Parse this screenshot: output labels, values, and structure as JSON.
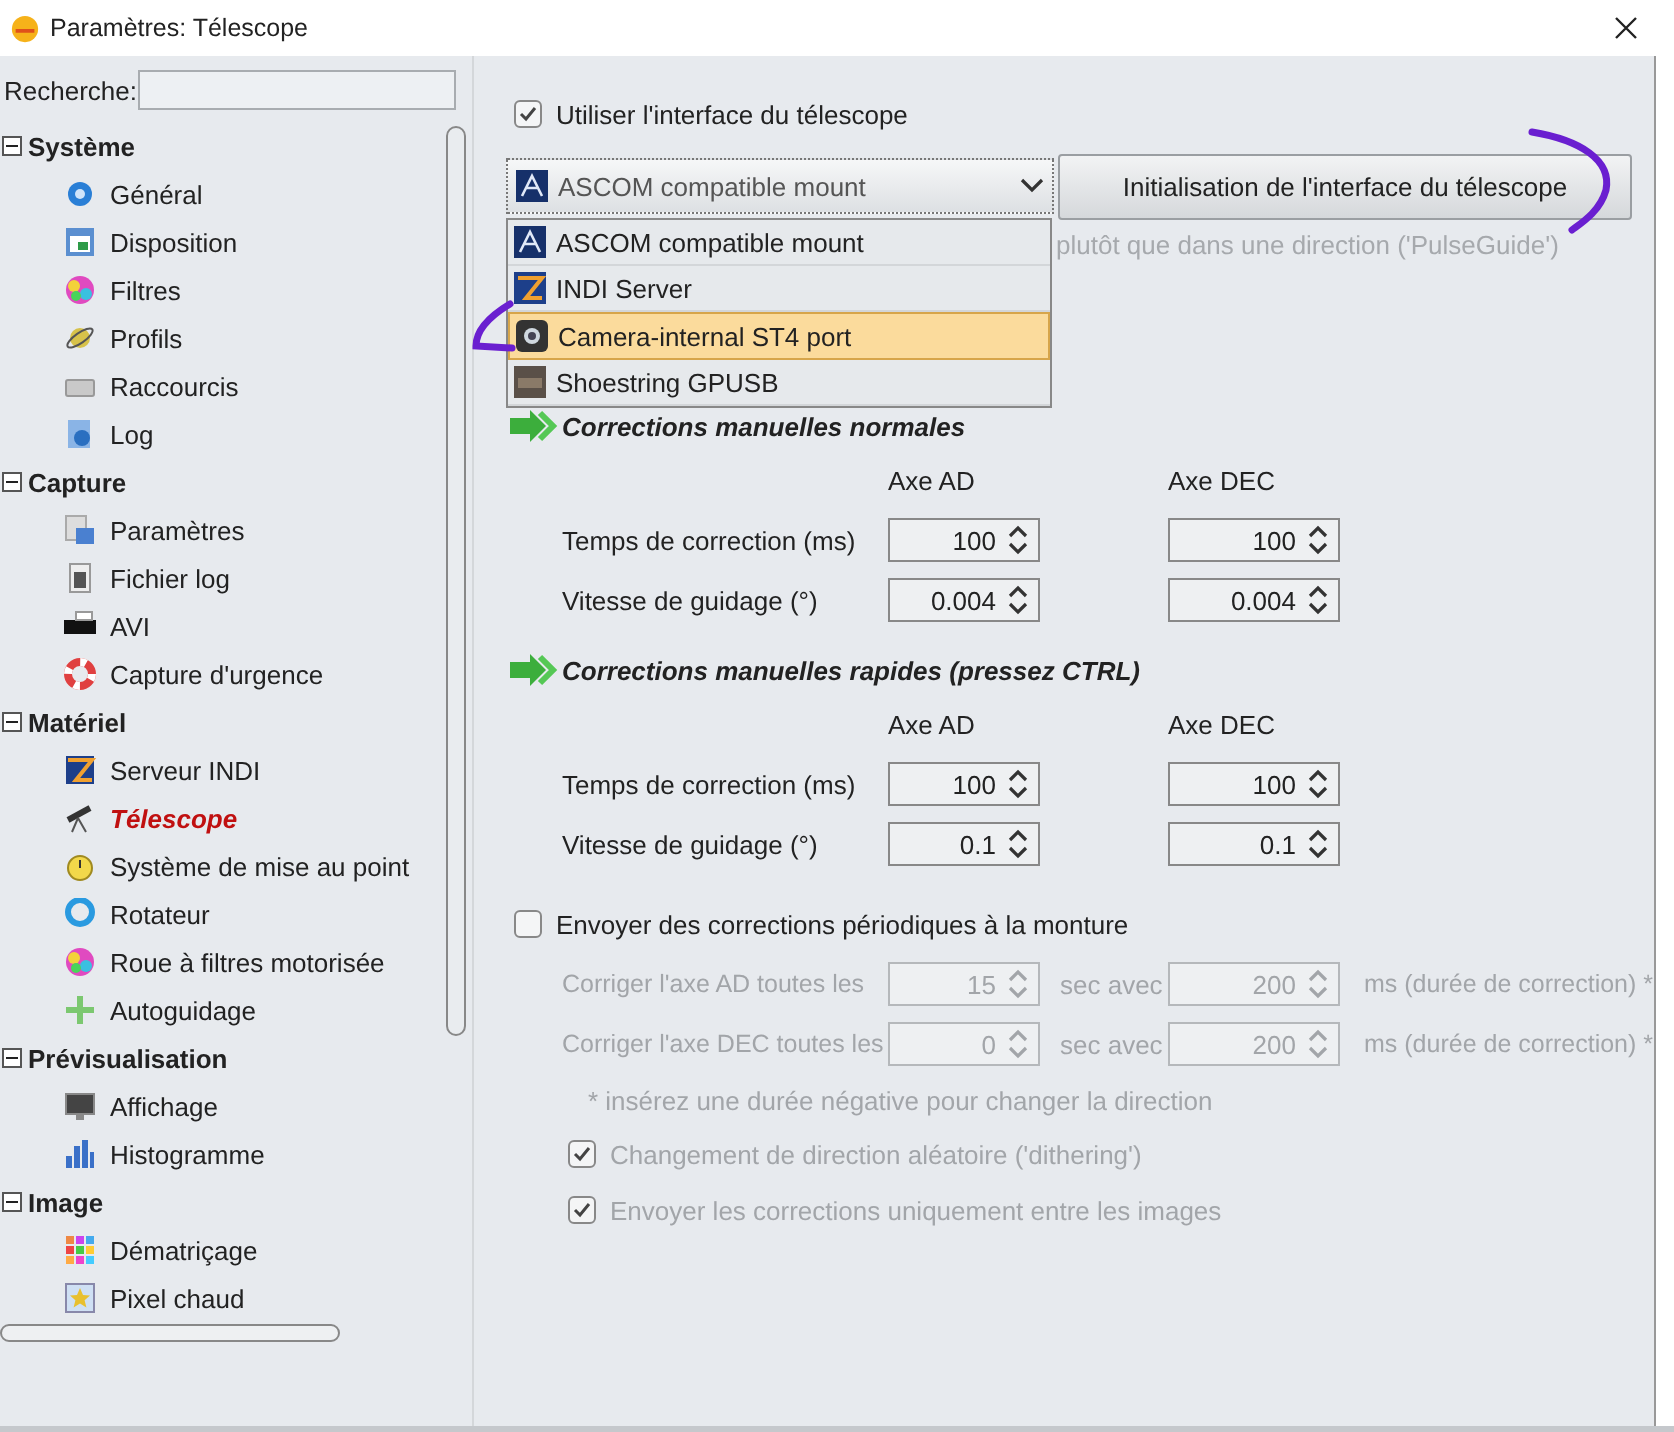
{
  "window": {
    "title": "Paramètres: Télescope"
  },
  "sidebar": {
    "search": {
      "label": "Recherche:"
    },
    "groups": [
      {
        "label": "Système",
        "expanded": true,
        "children": [
          {
            "label": "Général",
            "selected": false
          },
          {
            "label": "Disposition",
            "selected": false
          },
          {
            "label": "Filtres",
            "selected": false
          },
          {
            "label": "Profils",
            "selected": false
          },
          {
            "label": "Raccourcis",
            "selected": false
          },
          {
            "label": "Log",
            "selected": false
          }
        ]
      },
      {
        "label": "Capture",
        "expanded": true,
        "children": [
          {
            "label": "Paramètres",
            "selected": false
          },
          {
            "label": "Fichier log",
            "selected": false
          },
          {
            "label": "AVI",
            "selected": false
          },
          {
            "label": "Capture d'urgence",
            "selected": false
          }
        ]
      },
      {
        "label": "Matériel",
        "expanded": true,
        "children": [
          {
            "label": "Serveur INDI",
            "selected": false
          },
          {
            "label": "Télescope",
            "selected": true
          },
          {
            "label": "Système de mise au point",
            "selected": false
          },
          {
            "label": "Rotateur",
            "selected": false
          },
          {
            "label": "Roue à filtres motorisée",
            "selected": false
          },
          {
            "label": "Autoguidage",
            "selected": false
          }
        ]
      },
      {
        "label": "Prévisualisation",
        "expanded": true,
        "children": [
          {
            "label": "Affichage",
            "selected": false
          },
          {
            "label": "Histogramme",
            "selected": false
          }
        ]
      },
      {
        "label": "Image",
        "expanded": true,
        "children": [
          {
            "label": "Dématriçage",
            "selected": false
          },
          {
            "label": "Pixel chaud",
            "selected": false
          }
        ]
      }
    ]
  },
  "telescope": {
    "use_interface": {
      "label": "Utiliser l'interface du télescope",
      "checked": true
    },
    "mount_select": {
      "value": "ASCOM compatible mount",
      "expanded": true,
      "options": [
        {
          "label": "ASCOM compatible mount",
          "highlighted": false
        },
        {
          "label": "INDI Server",
          "highlighted": false
        },
        {
          "label": "Camera-internal ST4 port",
          "highlighted": true
        },
        {
          "label": "Shoestring GPUSB",
          "highlighted": false
        }
      ]
    },
    "init_button": "Initialisation de l'interface du télescope",
    "pulse_note": "plutôt que dans une direction ('PulseGuide')"
  },
  "sections": [
    {
      "title": "Corrections manuelles normales",
      "columns": [
        "Axe AD",
        "Axe DEC"
      ],
      "rows": [
        {
          "label": "Temps de correction (ms)",
          "values": [
            "100",
            "100"
          ]
        },
        {
          "label": "Vitesse de guidage (°)",
          "values": [
            "0.004",
            "0.004"
          ]
        }
      ]
    },
    {
      "title": "Corrections manuelles rapides (pressez CTRL)",
      "columns": [
        "Axe AD",
        "Axe DEC"
      ],
      "rows": [
        {
          "label": "Temps de correction (ms)",
          "values": [
            "100",
            "100"
          ]
        },
        {
          "label": "Vitesse de guidage (°)",
          "values": [
            "0.1",
            "0.1"
          ]
        }
      ]
    }
  ],
  "periodic": {
    "label": "Envoyer des corrections périodiques à la monture",
    "checked": false,
    "disabled": true,
    "rows": [
      {
        "label": "Corriger l'axe AD toutes les",
        "seconds": "15",
        "mid": "sec avec",
        "ms": "200",
        "unit": "ms (durée de correction) *"
      },
      {
        "label": "Corriger l'axe DEC toutes les",
        "seconds": "0",
        "mid": "sec avec",
        "ms": "200",
        "unit": "ms (durée de correction) *"
      }
    ],
    "note": "* insérez une durée négative pour changer la direction",
    "options": [
      {
        "label": "Changement de direction aléatoire ('dithering')",
        "checked": true
      },
      {
        "label": "Envoyer les corrections uniquement entre les images",
        "checked": true
      }
    ]
  }
}
